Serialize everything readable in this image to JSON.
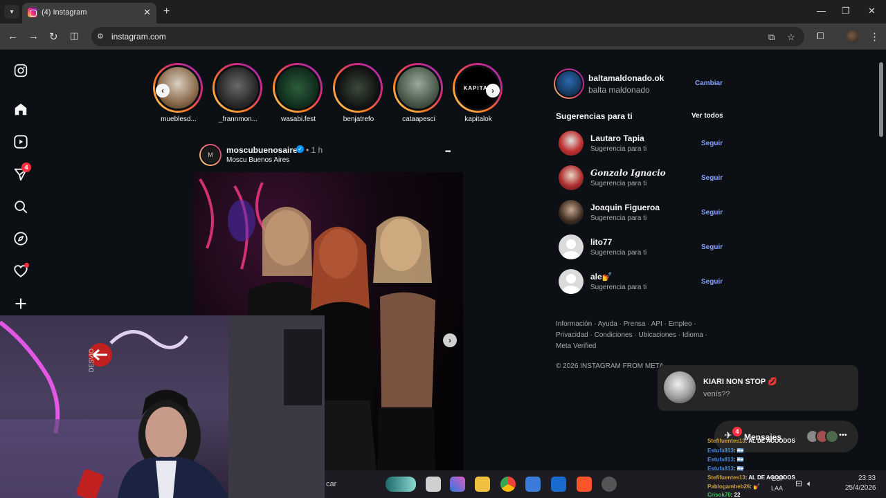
{
  "browser": {
    "tab_title": "(4) Instagram",
    "url": "instagram.com"
  },
  "leftnav": {
    "notifications_badge": "4"
  },
  "stories": [
    {
      "name": "mueblesd..."
    },
    {
      "name": "_frannmon..."
    },
    {
      "name": "wasabi.fest"
    },
    {
      "name": "benjatrefo"
    },
    {
      "name": "cataapesci"
    },
    {
      "name": "kapitalok"
    }
  ],
  "post": {
    "username": "moscubuenosaires",
    "time": "• 1 h",
    "location": "Moscu Buenos Aires",
    "more": "•••"
  },
  "account": {
    "username": "baltamaldonado.ok",
    "fullname": "balta maldonado",
    "switch_label": "Cambiar"
  },
  "suggestions": {
    "heading": "Sugerencias para ti",
    "see_all": "Ver todos",
    "items": [
      {
        "name": "Lautaro Tapia",
        "sub": "Sugerencia para ti",
        "action": "Seguir"
      },
      {
        "name": "𝑮𝒐𝒏𝒛𝒂𝒍𝒐 𝑰𝒈𝒏𝒂𝒄𝒊𝒐",
        "sub": "Sugerencia para ti",
        "action": "Seguir"
      },
      {
        "name": "Joaquin Figueroa",
        "sub": "Sugerencia para ti",
        "action": "Seguir"
      },
      {
        "name": "lito77",
        "sub": "Sugerencia para ti",
        "action": "Seguir"
      },
      {
        "name": "ale💅",
        "sub": "Sugerencia para ti",
        "action": "Seguir"
      }
    ]
  },
  "footer": {
    "line1": "Información · Ayuda · Prensa · API · Empleo ·",
    "line2": "Privacidad · Condiciones · Ubicaciones · Idioma ·",
    "line3": "Meta Verified",
    "copyright": "© 2026 INSTAGRAM FROM META"
  },
  "toast": {
    "title": "KIARI NON STOP 💋",
    "message": "venís??"
  },
  "messages": {
    "label": "Mensajes",
    "badge": "4"
  },
  "webcam": {
    "sign_text": "DESVIO"
  },
  "taskbar": {
    "search_text": "car",
    "lang1": "ESP",
    "lang2": "LAA",
    "time": "23:33",
    "date": "25/4/2026"
  },
  "chat": [
    {
      "user": "Stefifuentes13",
      "msg": ": AL DE AGOODOS"
    },
    {
      "user": "Estufa813",
      "msg": ": 🇦🇷"
    },
    {
      "user": "Estufa813",
      "msg": ": 🇦🇷"
    },
    {
      "user": "Estufa813",
      "msg": ": 🇦🇷"
    },
    {
      "user": "Stefifuentes13",
      "msg": ": AL DE AGOODOS"
    },
    {
      "user": "Pablogambeb26",
      "msg": ": 💅"
    },
    {
      "user": "Crisok70",
      "msg": ": 22"
    }
  ],
  "colors": {
    "background": "#0c1014",
    "link_blue": "#85a1ff",
    "badge_red": "#ff3040",
    "chrome_dark": "#1f1f1f"
  }
}
